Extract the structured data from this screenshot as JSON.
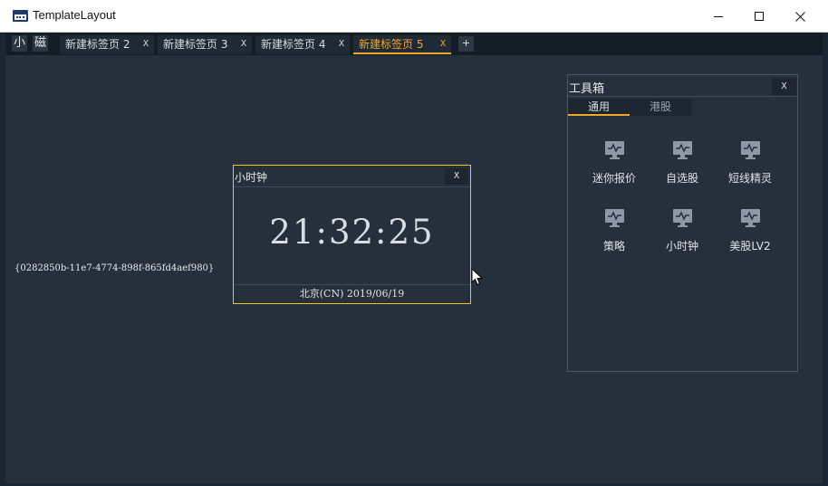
{
  "window": {
    "title": "TemplateLayout",
    "controls": {
      "minimize": "minimize",
      "maximize": "maximize",
      "close": "close"
    }
  },
  "tabbar": {
    "mini_buttons": [
      "小",
      "磁"
    ],
    "tabs": [
      {
        "label": "新建标签页 2",
        "close": "X",
        "active": false
      },
      {
        "label": "新建标签页 3",
        "close": "X",
        "active": false
      },
      {
        "label": "新建标签页 4",
        "close": "X",
        "active": false
      },
      {
        "label": "新建标签页 5",
        "close": "X",
        "active": true
      }
    ],
    "add_label": "+"
  },
  "workspace": {
    "guid": "{0282850b-11e7-4774-898f-865fd4aef980}"
  },
  "clock_widget": {
    "title": "小时钟",
    "close": "X",
    "time": "21:32:25",
    "footer": "北京(CN) 2019/06/19"
  },
  "toolbox": {
    "title": "工具箱",
    "close": "X",
    "tabs": [
      {
        "label": "通用",
        "active": true
      },
      {
        "label": "港股",
        "active": false
      }
    ],
    "tools": [
      {
        "label": "迷你报价",
        "icon": "monitor-chart-icon"
      },
      {
        "label": "自选股",
        "icon": "monitor-chart-icon"
      },
      {
        "label": "短线精灵",
        "icon": "monitor-chart-icon"
      },
      {
        "label": "策略",
        "icon": "monitor-chart-icon"
      },
      {
        "label": "小时钟",
        "icon": "monitor-chart-icon"
      },
      {
        "label": "美股LV2",
        "icon": "monitor-chart-icon"
      }
    ]
  },
  "colors": {
    "accent": "#f5a623",
    "clock_border": "#f5c518",
    "workspace_bg": "#262f3c",
    "icon_color": "#8e98a6"
  }
}
